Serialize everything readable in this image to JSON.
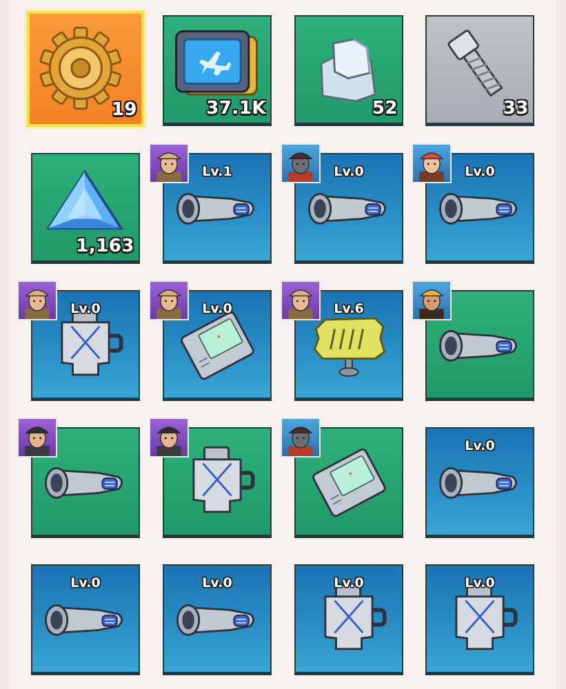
{
  "inventory": {
    "rows": [
      [
        {
          "item": "gear-icon",
          "bg": "orange",
          "count": "19",
          "selected": true
        },
        {
          "item": "plane-blueprint-icon",
          "bg": "green",
          "count": "37.1K"
        },
        {
          "item": "metal-ingot-icon",
          "bg": "green",
          "count": "52"
        },
        {
          "item": "bolt-icon",
          "bg": "gray",
          "count": "33"
        }
      ],
      [
        {
          "item": "blue-crystal-icon",
          "bg": "green",
          "count": "1,163"
        },
        {
          "item": "scope-part-icon",
          "bg": "blue",
          "level": "Lv.1",
          "portrait": "hat-explorer-portrait",
          "portrait_bg": "purple"
        },
        {
          "item": "scope-part-icon",
          "bg": "blue",
          "level": "Lv.0",
          "portrait": "gasmask-soldier-portrait",
          "portrait_bg": "blue"
        },
        {
          "item": "scope-part-icon",
          "bg": "blue",
          "level": "Lv.0",
          "portrait": "red-cap-kid-portrait",
          "portrait_bg": "blue"
        }
      ],
      [
        {
          "item": "armor-plate-icon",
          "bg": "blue",
          "level": "Lv.0",
          "portrait": "hat-explorer-portrait",
          "portrait_bg": "purple"
        },
        {
          "item": "data-pad-icon",
          "bg": "blue",
          "level": "Lv.0",
          "portrait": "hat-explorer-portrait",
          "portrait_bg": "purple"
        },
        {
          "item": "yellow-shield-icon",
          "bg": "blue",
          "level": "Lv.6",
          "portrait": "hat-explorer-portrait",
          "portrait_bg": "purple"
        },
        {
          "item": "scope-part-icon",
          "bg": "green",
          "portrait": "yellow-cap-pilot-portrait",
          "portrait_bg": "blue"
        }
      ],
      [
        {
          "item": "scope-part-icon",
          "bg": "green",
          "portrait": "bearded-man-portrait",
          "portrait_bg": "purple"
        },
        {
          "item": "armor-plate-icon",
          "bg": "green",
          "portrait": "bearded-man-portrait",
          "portrait_bg": "purple"
        },
        {
          "item": "data-pad-icon",
          "bg": "green",
          "portrait": "gasmask-soldier-portrait",
          "portrait_bg": "blue"
        },
        {
          "item": "scope-part-icon",
          "bg": "blue",
          "level": "Lv.0"
        }
      ],
      [
        {
          "item": "scope-part-icon",
          "bg": "blue",
          "level": "Lv.0"
        },
        {
          "item": "scope-part-icon",
          "bg": "blue",
          "level": "Lv.0"
        },
        {
          "item": "armor-plate-icon",
          "bg": "blue",
          "level": "Lv.0"
        },
        {
          "item": "armor-plate-icon",
          "bg": "blue",
          "level": "Lv.0"
        }
      ]
    ]
  }
}
